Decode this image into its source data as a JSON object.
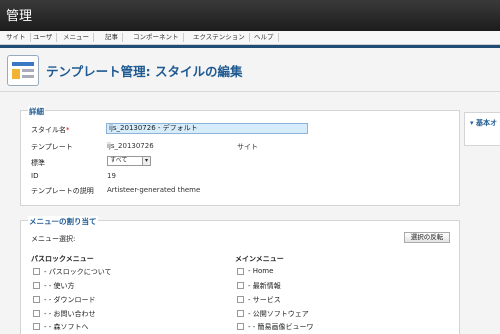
{
  "app": {
    "title": "管理"
  },
  "menu": [
    "サイト",
    "ユーザ",
    "メニュー",
    "記事",
    "コンポーネント",
    "エクステンション",
    "ヘルプ"
  ],
  "header": {
    "title": "テンプレート管理: スタイルの編集"
  },
  "details": {
    "legend": "詳細",
    "style_name_label": "スタイル名",
    "required_mark": "*",
    "style_name_value": "ijs_20130726 - デフォルト",
    "template_label": "テンプレート",
    "template_value": "ijs_20130726",
    "site_value": "サイト",
    "default_label": "標準",
    "default_value": "すべて",
    "id_label": "ID",
    "id_value": "19",
    "desc_label": "テンプレートの説明",
    "desc_value": "Artisteer-generated theme"
  },
  "menu_assignment": {
    "legend": "メニューの割り当て",
    "select_label": "メニュー選択:",
    "toggle_button": "選択の反転",
    "columns": [
      {
        "title": "パスロックメニュー",
        "items": [
          "- パスロックについて",
          "- - 使い方",
          "- - ダウンロード",
          "- - お問い合わせ",
          "- - 森ソフトへ"
        ]
      },
      {
        "title": "メインメニュー",
        "items": [
          "- Home",
          "- 最新情報",
          "- サービス",
          "- 公開ソフトウェア",
          "- - 簡易画像ビューワ"
        ]
      }
    ]
  },
  "sidebar": {
    "title": "基本オ"
  },
  "icons": {
    "dropdown": "chevron-down-icon",
    "collapse": "triangle-down-icon"
  }
}
